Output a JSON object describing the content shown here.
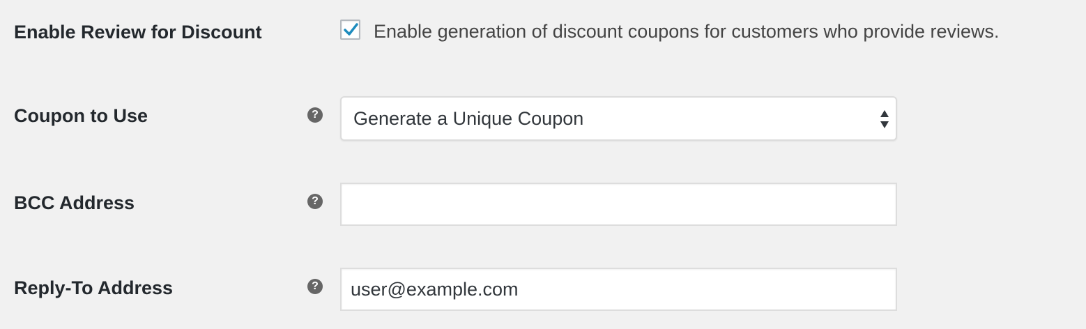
{
  "settings": {
    "enable_review": {
      "label": "Enable Review for Discount",
      "checked": true,
      "description": "Enable generation of discount coupons for customers who provide reviews."
    },
    "coupon_to_use": {
      "label": "Coupon to Use",
      "help_icon": "?",
      "selected": "Generate a Unique Coupon"
    },
    "bcc_address": {
      "label": "BCC Address",
      "help_icon": "?",
      "value": ""
    },
    "reply_to_address": {
      "label": "Reply-To Address",
      "help_icon": "?",
      "value": "user@example.com"
    }
  },
  "colors": {
    "background": "#f1f1f1",
    "check_accent": "#1e8cbe",
    "help_icon_bg": "#666666"
  }
}
